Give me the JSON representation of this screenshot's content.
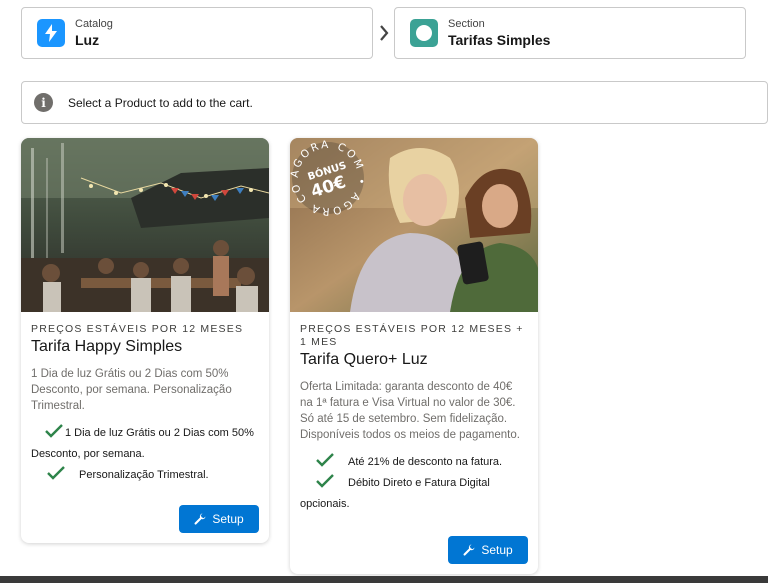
{
  "breadcrumb": {
    "catalog": {
      "label": "Catalog",
      "value": "Luz"
    },
    "section": {
      "label": "Section",
      "value": "Tarifas Simples"
    }
  },
  "info": {
    "text": "Select a Product to add to the cart."
  },
  "products": [
    {
      "eyebrow": "PREÇOS ESTÁVEIS POR 12 MESES",
      "title": "Tarifa Happy Simples",
      "description": "1 Dia de luz Grátis ou 2 Dias com 50% Desconto, por semana. Personalização Trimestral.",
      "features": [
        "1 Dia de luz Grátis ou 2 Dias com 50% Desconto, por semana.",
        "Personalização Trimestral."
      ],
      "button": "Setup"
    },
    {
      "eyebrow": "PREÇOS ESTÁVEIS POR 12 MESES + 1 MES",
      "title": "Tarifa Quero+ Luz",
      "description": "Oferta Limitada: garanta desconto de 40€ na 1ª fatura e Visa Virtual no valor de 30€. Só até 15 de setembro. Sem fidelização. Disponíveis todos os meios de pagamento.",
      "features": [
        "Até 21% de desconto na fatura.",
        "Débito Direto e Fatura Digital opcionais."
      ],
      "button": "Setup",
      "badge": {
        "ring": "AGORA COM • AGORA COM •",
        "top": "BÓNUS",
        "amount": "40€"
      }
    }
  ],
  "colors": {
    "accent": "#0176d3",
    "check": "#2e844a",
    "catalog_icon": "#1b96ff",
    "section_icon": "#3ba295"
  }
}
